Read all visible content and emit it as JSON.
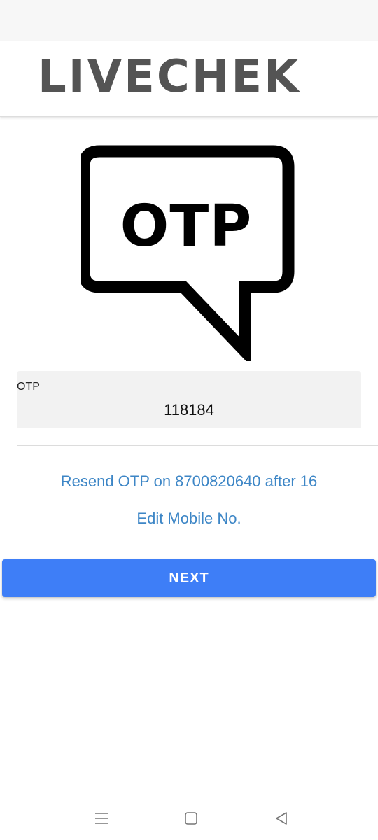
{
  "header": {
    "logo_text": "LIVECHEK"
  },
  "illustration": {
    "text": "OTP",
    "icon": "speech-bubble-icon"
  },
  "otp_field": {
    "label": "OTP",
    "value": "118184"
  },
  "links": {
    "resend": "Resend OTP on 8700820640 after 16",
    "edit_mobile": "Edit Mobile No."
  },
  "actions": {
    "next_label": "NEXT"
  },
  "nav_bar": {
    "items": [
      "menu-icon",
      "home-square-icon",
      "back-triangle-icon"
    ]
  },
  "colors": {
    "logo": "#545454",
    "link": "#3d86c6",
    "primary_button": "#3e7ef7",
    "field_background": "#f2f2f2"
  }
}
